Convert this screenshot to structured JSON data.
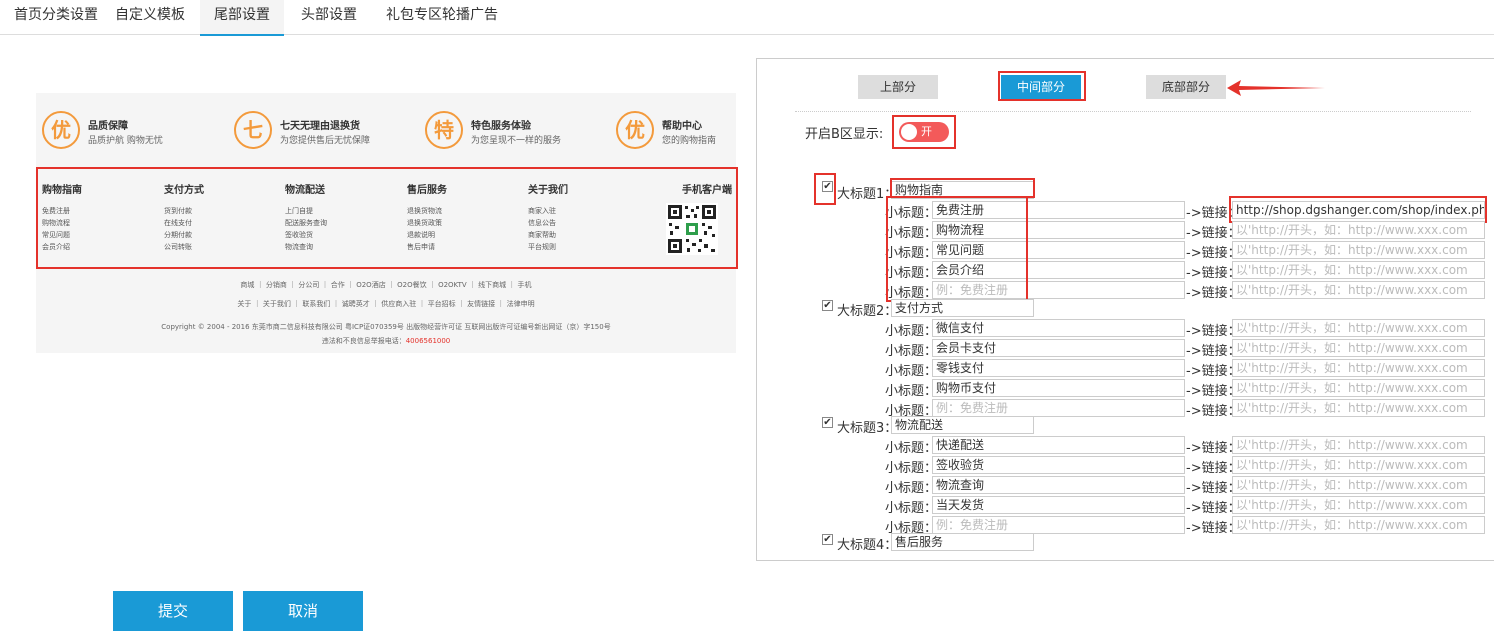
{
  "tabs": [
    "首页分类设置",
    "自定义模板",
    "尾部设置",
    "头部设置",
    "礼包专区轮播广告"
  ],
  "preview": {
    "promos": [
      {
        "char": "优",
        "title": "品质保障",
        "sub": "品质护航 购物无忧"
      },
      {
        "char": "七",
        "title": "七天无理由退换货",
        "sub": "为您提供售后无忧保障"
      },
      {
        "char": "特",
        "title": "特色服务体验",
        "sub": "为您呈现不一样的服务"
      },
      {
        "char": "优",
        "title": "帮助中心",
        "sub": "您的购物指南"
      }
    ],
    "columns": [
      {
        "title": "购物指南",
        "items": [
          "免费注册",
          "购物流程",
          "常见问题",
          "会员介绍"
        ]
      },
      {
        "title": "支付方式",
        "items": [
          "货到付款",
          "在线支付",
          "分期付款",
          "公司转账"
        ]
      },
      {
        "title": "物流配送",
        "items": [
          "上门自提",
          "配送服务查询",
          "签收验货",
          "物流查询"
        ]
      },
      {
        "title": "售后服务",
        "items": [
          "退换货物流",
          "退换货政策",
          "退款说明",
          "售后申请"
        ]
      },
      {
        "title": "关于我们",
        "items": [
          "商家入驻",
          "信息公告",
          "商家帮助",
          "平台规则"
        ]
      }
    ],
    "mobile_title": "手机客户端",
    "links_row1": "商城 ｜ 分销商 ｜ 分公司 ｜ 合作 ｜ O2O酒店 ｜ O2O餐饮 ｜ O2OKTV ｜ 线下商城 ｜ 手机",
    "links_row2": "关于 ｜ 关于我们 ｜ 联系我们 ｜ 诚聘英才 ｜ 供应商入驻 ｜ 平台招标 ｜ 友情链接 ｜ 法律申明",
    "copyright": "Copyright © 2004 - 2016 东莞市商二信息科技有限公司 粤ICP证070359号 出版物经营许可证 互联网出版许可证编号新出网证（京）字150号",
    "report_text": "违法和不良信息举报电话：",
    "report_phone": "4006561000"
  },
  "config": {
    "segments": [
      "上部分",
      "中间部分",
      "底部部分"
    ],
    "active_segment": "中间部分",
    "enable_label": "开启B区显示:",
    "toggle_text": "开",
    "main_label_prefix": "大标题",
    "sub_label": "小标题：",
    "link_label": "->链接：",
    "link_placeholder": "以'http://开头，如：http://www.xxx.com",
    "sub_placeholder": "例：免费注册",
    "groups": [
      {
        "index": "1：",
        "title": "购物指南",
        "subs": [
          "免费注册",
          "购物流程",
          "常见问题",
          "会员介绍"
        ],
        "links": [
          "http://shop.dgshanger.com/shop/index.php/Home"
        ]
      },
      {
        "index": "2：",
        "title": "支付方式",
        "subs": [
          "微信支付",
          "会员卡支付",
          "零钱支付",
          "购物币支付"
        ],
        "links": []
      },
      {
        "index": "3：",
        "title": "物流配送",
        "subs": [
          "快递配送",
          "签收验货",
          "物流查询",
          "当天发货"
        ],
        "links": []
      },
      {
        "index": "4：",
        "title": "售后服务",
        "subs": [],
        "links": []
      }
    ]
  },
  "buttons": {
    "submit": "提交",
    "cancel": "取消"
  },
  "colors": {
    "accent": "#1a9ad6",
    "highlight": "#e4322b",
    "promo": "#f39a3c"
  }
}
